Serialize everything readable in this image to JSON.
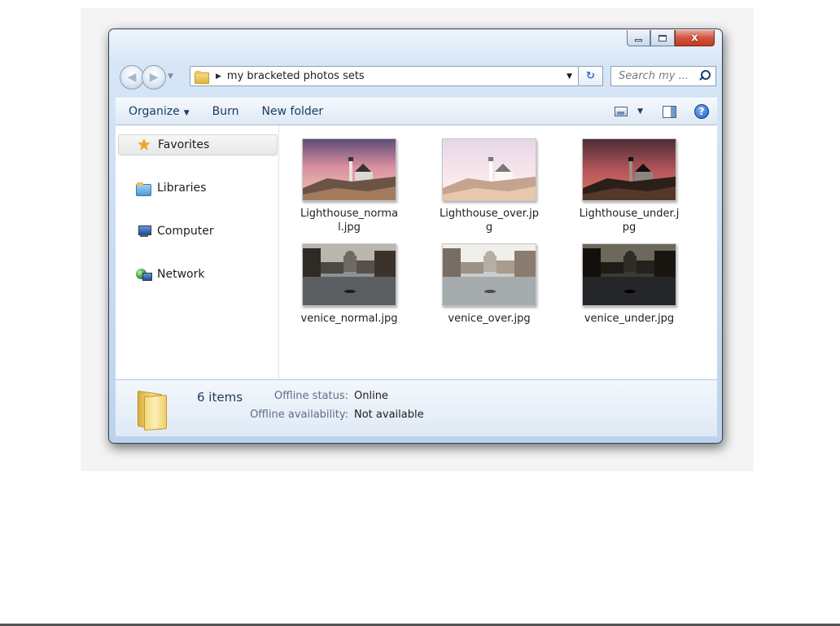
{
  "window": {
    "caption": {
      "minimize": "",
      "maximize": "",
      "close": "x"
    }
  },
  "address": {
    "path": "my bracketed photos sets",
    "search_placeholder": "Search my ...",
    "separator": "▶",
    "dropdown": "▼"
  },
  "toolbar": {
    "organize_label": "Organize",
    "burn_label": "Burn",
    "new_folder_label": "New folder",
    "caret": "▼",
    "help": "?"
  },
  "nav": {
    "items": [
      {
        "label": "Favorites",
        "icon": "star-icon"
      },
      {
        "label": "Libraries",
        "icon": "libraries-icon"
      },
      {
        "label": "Computer",
        "icon": "computer-icon"
      },
      {
        "label": "Network",
        "icon": "network-icon"
      }
    ]
  },
  "files": [
    {
      "name": "Lighthouse_normal.jpg",
      "thumb": "lighthouse-normal"
    },
    {
      "name": "Lighthouse_over.jpg",
      "thumb": "lighthouse-over"
    },
    {
      "name": "Lighthouse_under.jpg",
      "thumb": "lighthouse-under"
    },
    {
      "name": "venice_normal.jpg",
      "thumb": "venice-normal"
    },
    {
      "name": "venice_over.jpg",
      "thumb": "venice-over"
    },
    {
      "name": "venice_under.jpg",
      "thumb": "venice-under"
    }
  ],
  "status": {
    "count": "6 items",
    "offline_status_label": "Offline status:",
    "offline_status_value": "Online",
    "offline_availability_label": "Offline availability:",
    "offline_availability_value": "Not available"
  },
  "colors": {
    "accent": "#1e3a5f",
    "frame": "#c7dbf2",
    "close_button": "#c23b22"
  }
}
